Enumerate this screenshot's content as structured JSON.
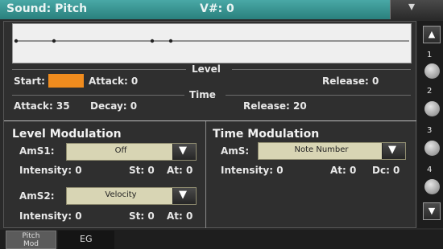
{
  "header": {
    "title": "Sound: Pitch",
    "velocity": "V#: 0",
    "menu_icon": "triangle-down"
  },
  "level": {
    "label": "Level",
    "start_label": "Start:",
    "start_value": "",
    "attack_label": "Attack: 0",
    "release_label": "Release: 0"
  },
  "time": {
    "label": "Time",
    "attack_label": "Attack: 35",
    "decay_label": "Decay: 0",
    "release_label": "Release: 20"
  },
  "level_modulation": {
    "title": "Level Modulation",
    "amsl_label": "AmS1:",
    "amsl_value": "Off",
    "intensity1": "Intensity: 0",
    "st1": "St: 0",
    "at1": "At: 0",
    "ams2_label": "AmS2:",
    "ams2_value": "Velocity",
    "intensity2": "Intensity: 0",
    "st2": "St: 0",
    "at2": "At: 0"
  },
  "time_modulation": {
    "title": "Time Modulation",
    "ams_label": "AmS:",
    "ams_value": "Note Number",
    "intensity": "Intensity: 0",
    "at": "At: 0",
    "dc": "Dc: 0"
  },
  "strip": {
    "up": "▲",
    "down": "▼",
    "labels": [
      "1",
      "2",
      "3",
      "4"
    ]
  },
  "tabs": {
    "tab1_line1": "Pitch",
    "tab1_line2": "Mod",
    "tab2": "EG"
  },
  "colors": {
    "titlebar": "#3a9896",
    "highlight": "#f08c1e",
    "dropdown": "#d8d5b4"
  }
}
